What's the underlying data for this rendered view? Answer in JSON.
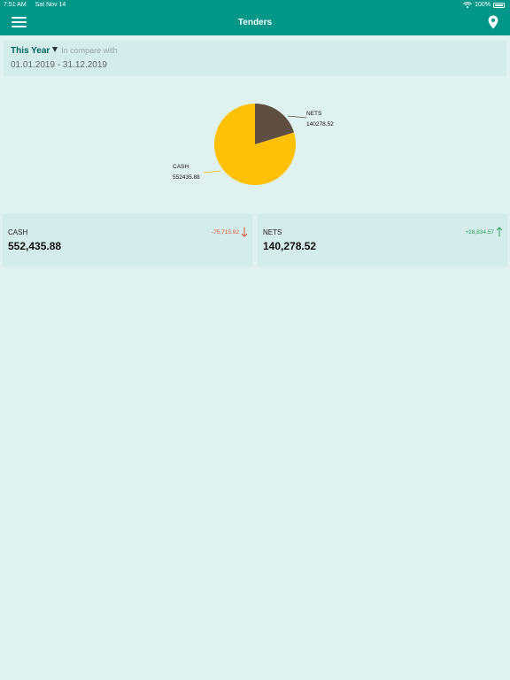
{
  "status_bar": {
    "time": "7:51 AM",
    "date": "Sat Nov 14",
    "battery": "100%"
  },
  "app_bar": {
    "title": "Tenders"
  },
  "filter": {
    "period": "This Year",
    "compare_label": "In compare with",
    "date_range": "01.01.2019 - 31.12.2019"
  },
  "chart_data": {
    "type": "pie",
    "categories": [
      "CASH",
      "NETS"
    ],
    "values": [
      552435.88,
      140278.52
    ],
    "labels": [
      {
        "name": "CASH",
        "value": "552435.88"
      },
      {
        "name": "NETS",
        "value": "140278.52"
      }
    ],
    "colors": [
      "#ffc107",
      "#5d4e41"
    ]
  },
  "tenders": [
    {
      "name": "CASH",
      "amount": "552,435.88",
      "change": "-75,715.92",
      "direction": "down"
    },
    {
      "name": "NETS",
      "amount": "140,278.52",
      "change": "+28,834.57",
      "direction": "up"
    }
  ],
  "colors": {
    "primary": "#009688",
    "background": "#e0f2ef",
    "card": "#d4ecea",
    "down": "#e35934",
    "up": "#2e9d5b"
  }
}
